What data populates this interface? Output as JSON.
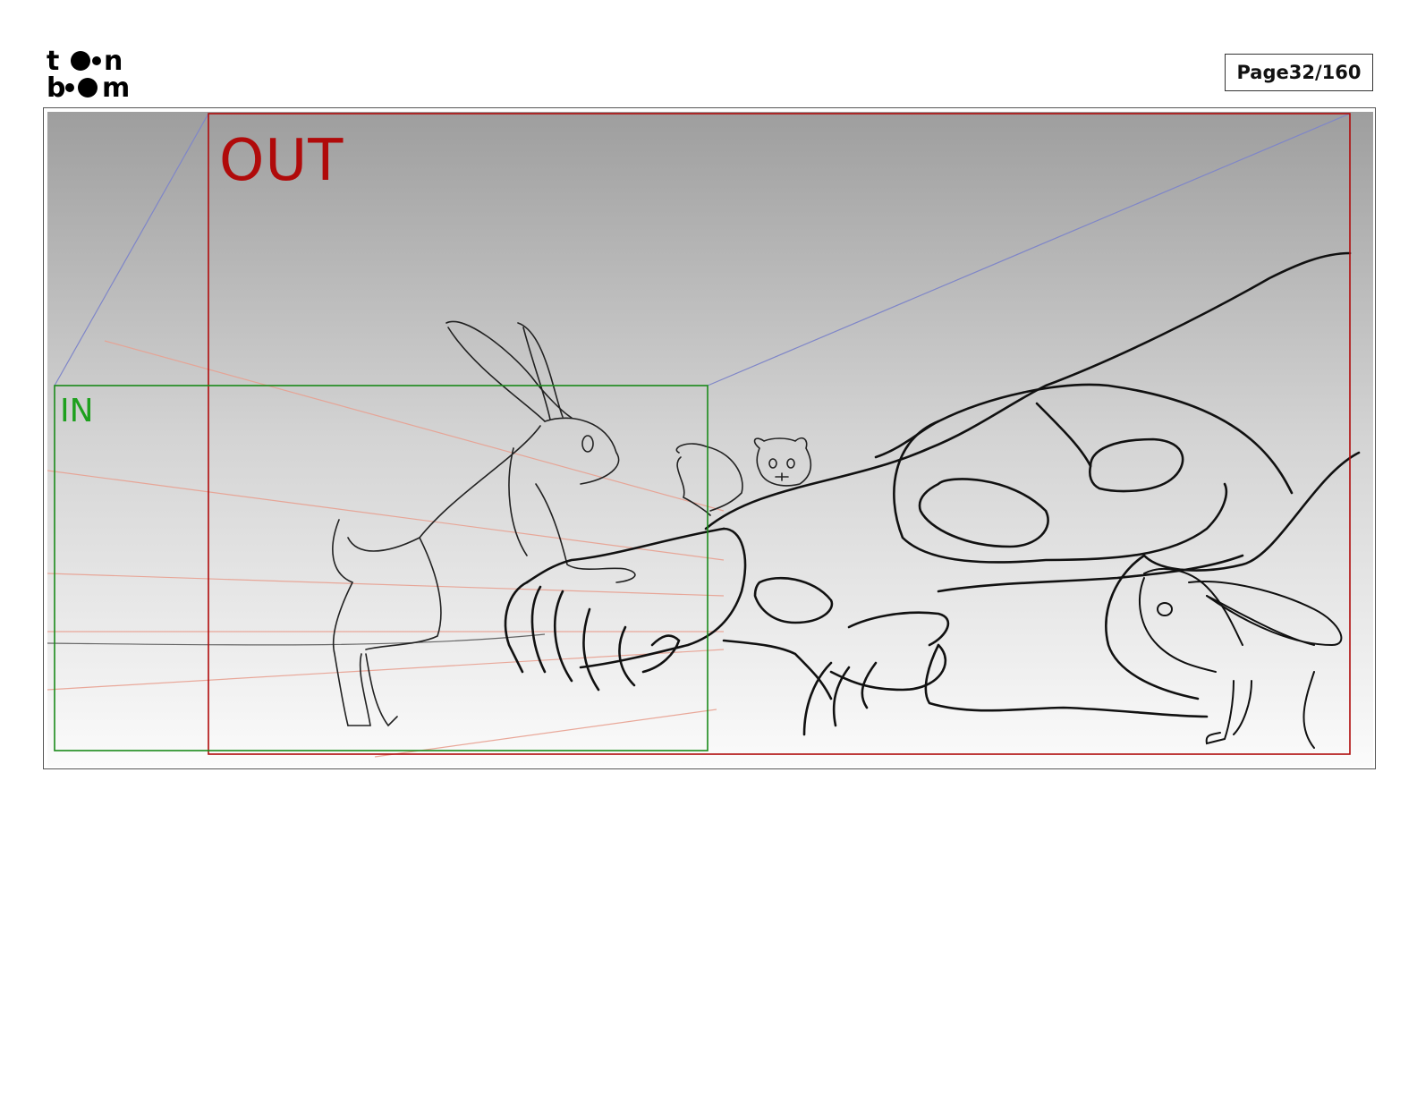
{
  "brand": {
    "logo_line1": "toon",
    "logo_line2": "boom"
  },
  "header": {
    "page_label": "Page",
    "page_number": "32/160"
  },
  "panel": {
    "out_label": "OUT",
    "in_label": "IN"
  },
  "colors": {
    "out_frame": "#b00a0a",
    "in_frame": "#1a8a1a",
    "perspective": "#7f86c8",
    "guides": "#e8a090",
    "sketch": "#111111"
  }
}
